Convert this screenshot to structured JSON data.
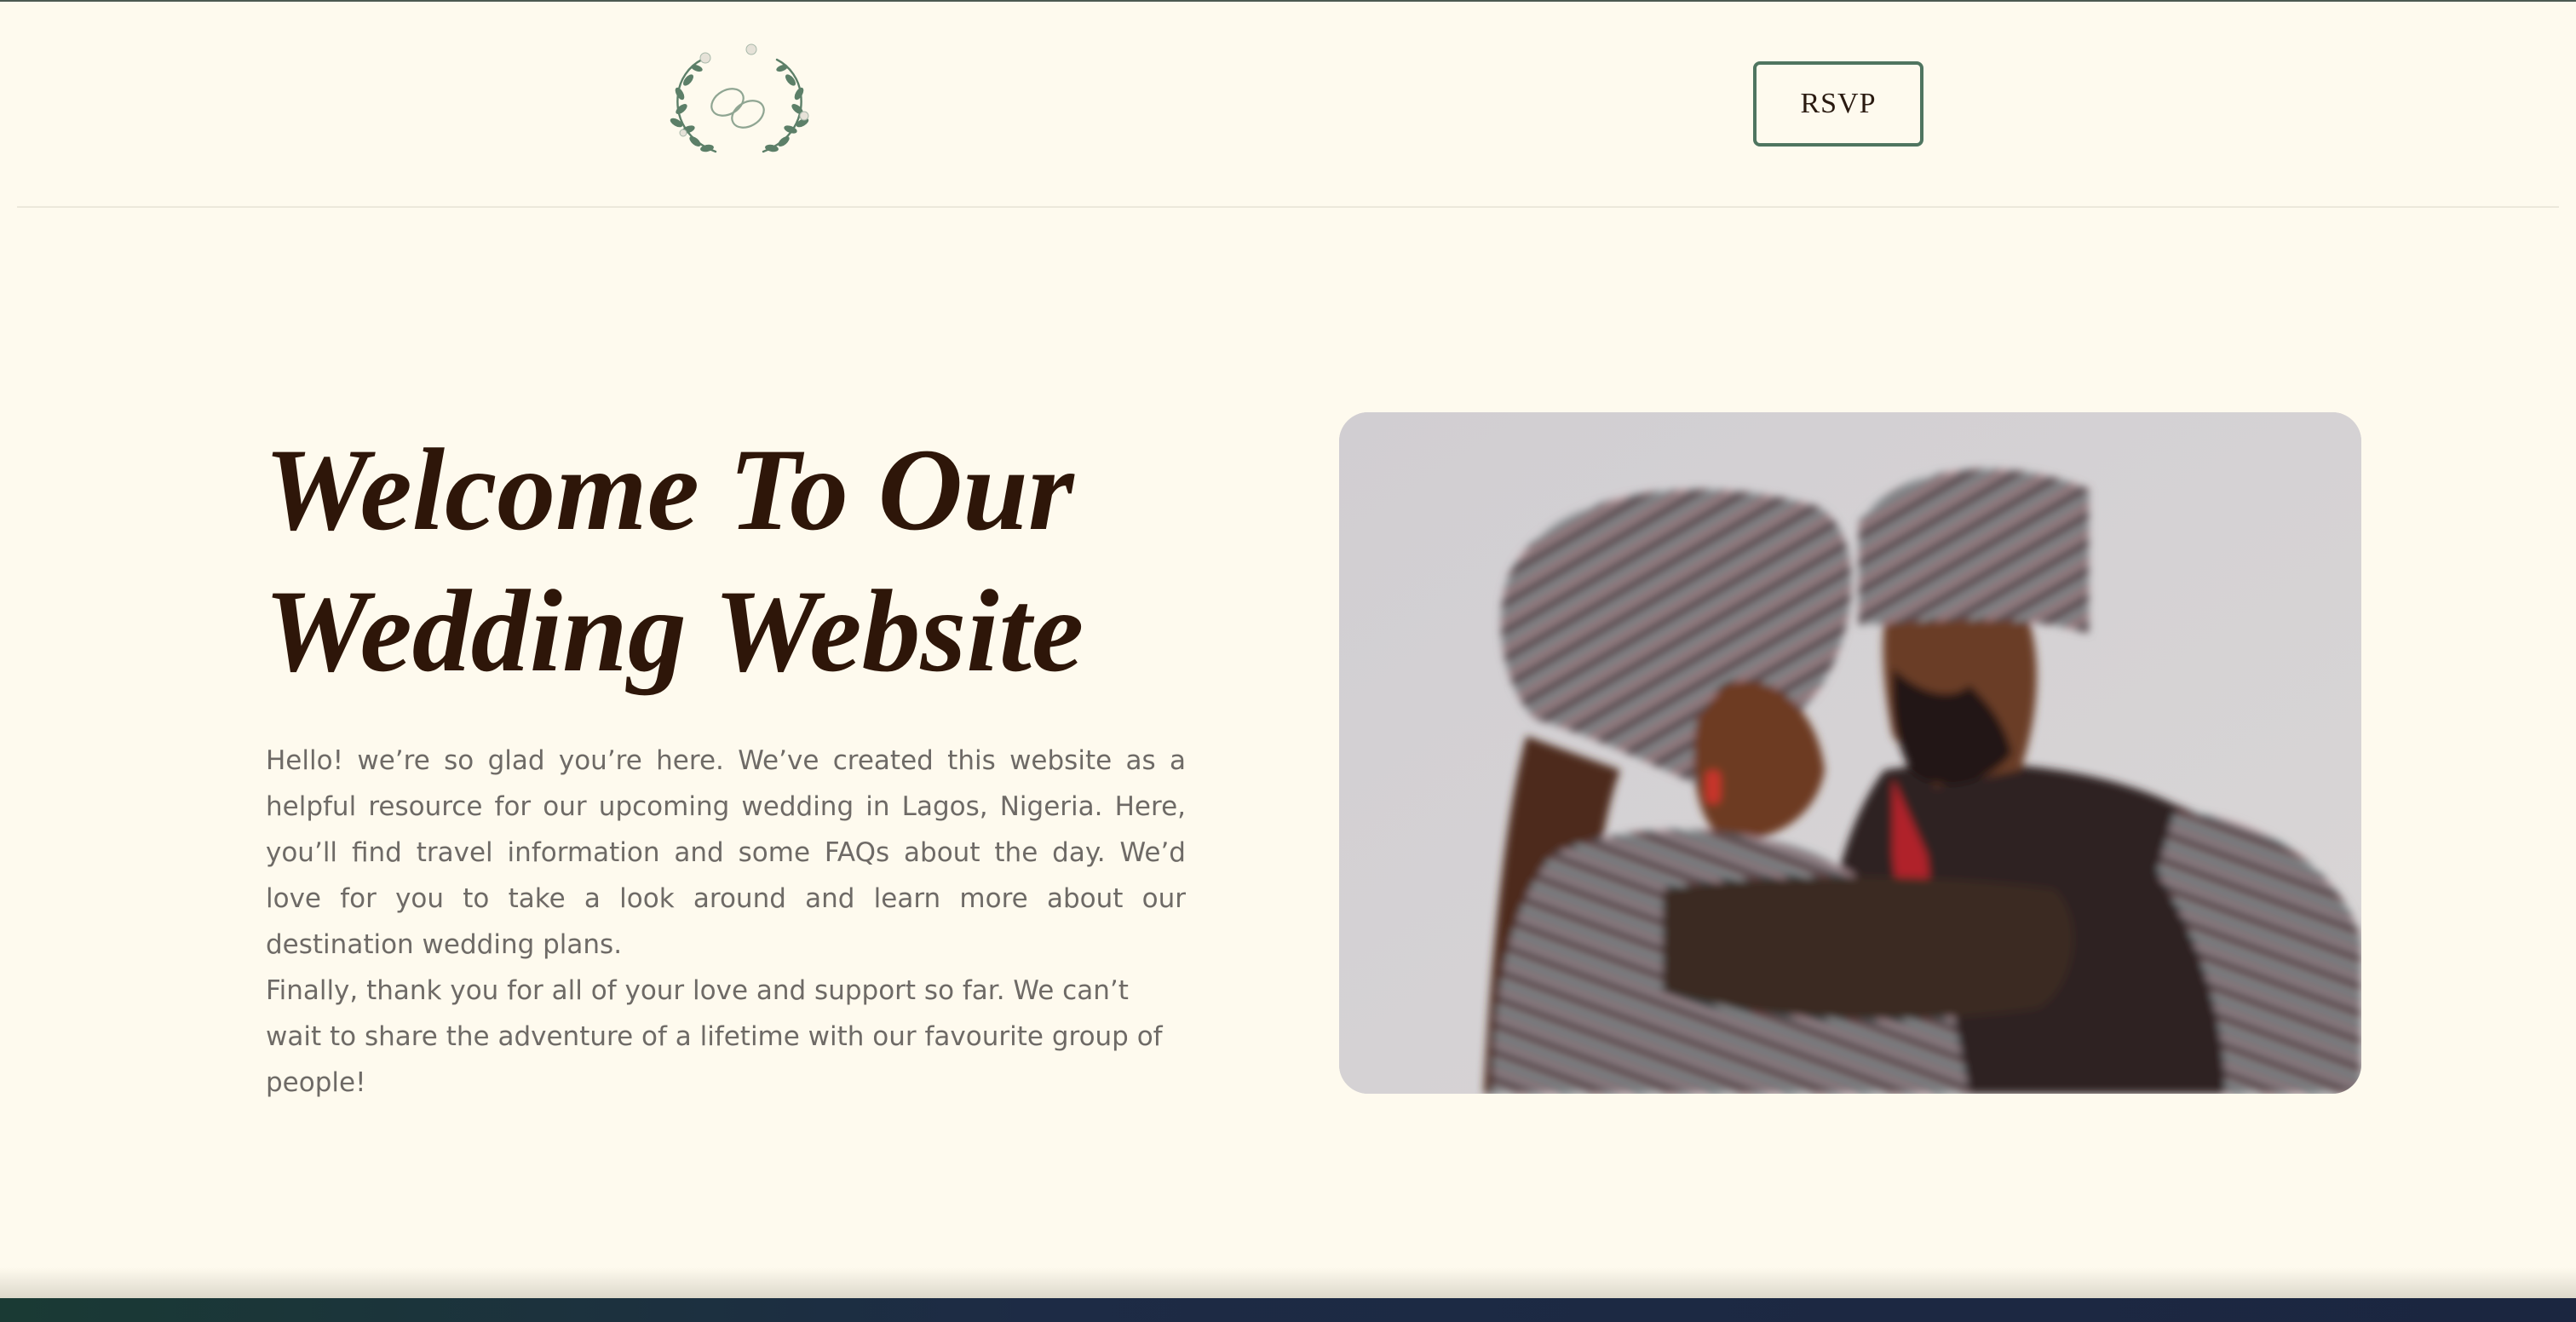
{
  "header": {
    "logo_icon": "wedding-monogram-wreath-icon",
    "rsvp_label": "RSVP"
  },
  "hero": {
    "title_line1": "Welcome To Our",
    "title_line2": "Wedding Website",
    "paragraph1": "Hello! we’re so glad you’re here. We’ve created this website as a helpful resource for our upcoming wedding in Lagos, Nigeria. Here, you’ll find travel information and some FAQs about the day. We’d love for you to take a look around and learn more about our destination wedding plans.",
    "paragraph2": "Finally, thank you for all of your love and support so far. We can’t wait to share the adventure of a lifetime with our favourite group of people!"
  },
  "colors": {
    "background": "#fefaee",
    "heading": "#2e1609",
    "body_text": "#6e6a66",
    "accent_green": "#4f7560"
  }
}
